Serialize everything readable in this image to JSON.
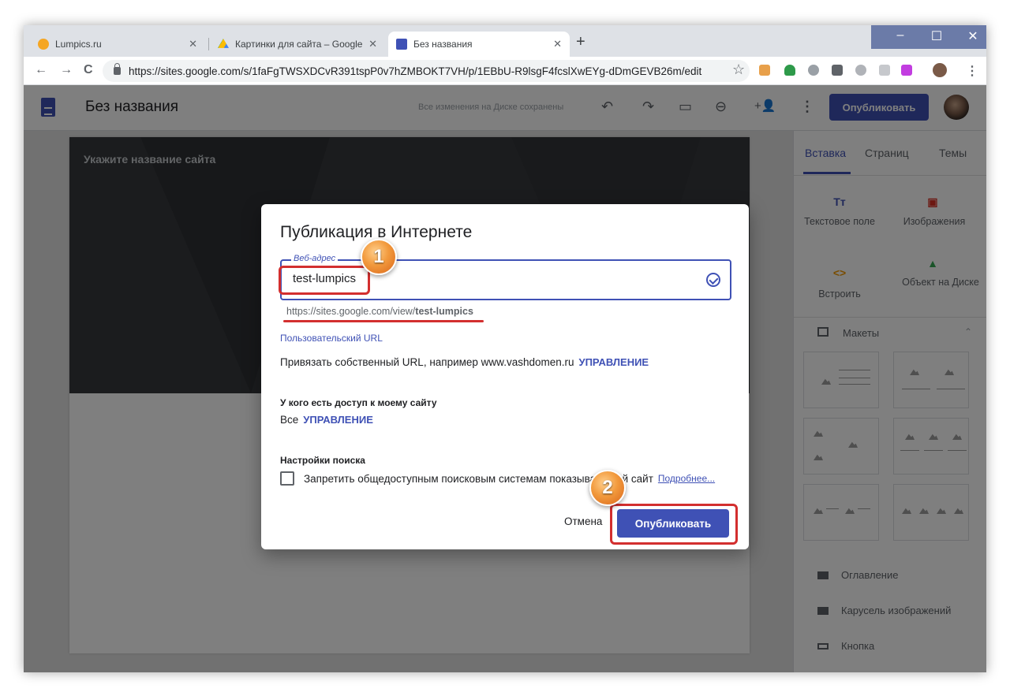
{
  "browser": {
    "tabs": [
      {
        "title": "Lumpics.ru",
        "close": "✕"
      },
      {
        "title": "Картинки для сайта – Google Ди",
        "close": "✕"
      },
      {
        "title": "Без названия",
        "close": "✕"
      }
    ],
    "new_tab": "+",
    "window_controls": {
      "minimize": "–",
      "maximize": "☐",
      "close": "✕"
    },
    "url": "https://sites.google.com/s/1faFgTWSXDCvR391tspP0v7hZMBOKT7VH/p/1EBbU-R9lsgF4fcslXwEYg-dDmGEVB26m/edit",
    "nav": {
      "back": "←",
      "forward": "→",
      "reload": "C"
    },
    "bookmark_star": "☆",
    "menu": "⋮"
  },
  "sites_header": {
    "title": "Без названия",
    "saved_status": "Все изменения на Диске сохранены",
    "publish_label": "Опубликовать",
    "icons": {
      "undo": "↶",
      "redo": "↷",
      "preview": "▭",
      "link": "⊖",
      "share": "+👤",
      "more": "⋮"
    }
  },
  "canvas": {
    "site_title_placeholder": "Укажите название сайта"
  },
  "side_panel": {
    "tabs": [
      "Вставка",
      "Страниц",
      "Темы"
    ],
    "items": [
      {
        "icon": "Tт",
        "label": "Текстовое поле"
      },
      {
        "icon": "▣",
        "label": "Изображения"
      },
      {
        "icon": "<>",
        "label": "Встроить"
      },
      {
        "icon": "▲",
        "label": "Объект на Диске"
      }
    ],
    "layouts_label": "Макеты",
    "list": [
      "Оглавление",
      "Карусель изображений",
      "Кнопка"
    ]
  },
  "dialog": {
    "title": "Публикация в Интернете",
    "field_label": "Веб-адрес",
    "field_value": "test-lumpics",
    "url_prefix": "https://sites.google.com/view/",
    "url_suffix": "test-lumpics",
    "custom_url_heading": "Пользовательский URL",
    "custom_url_text": "Привязать собственный URL, например www.vashdomen.ru",
    "manage_label": "УПРАВЛЕНИЕ",
    "access_heading": "У кого есть доступ к моему сайту",
    "access_value": "Все",
    "search_heading": "Настройки поиска",
    "search_checkbox_text": "Запретить общедоступным поисковым системам показывать мой сайт",
    "more_link": "Подробнее...",
    "cancel_label": "Отмена",
    "publish_label": "Опубликовать"
  },
  "annotations": {
    "badge_1": "1",
    "badge_2": "2"
  },
  "colors": {
    "accent": "#3f51b5",
    "highlight_red": "#d32f2f",
    "badge_orange": "#f29a3d"
  }
}
